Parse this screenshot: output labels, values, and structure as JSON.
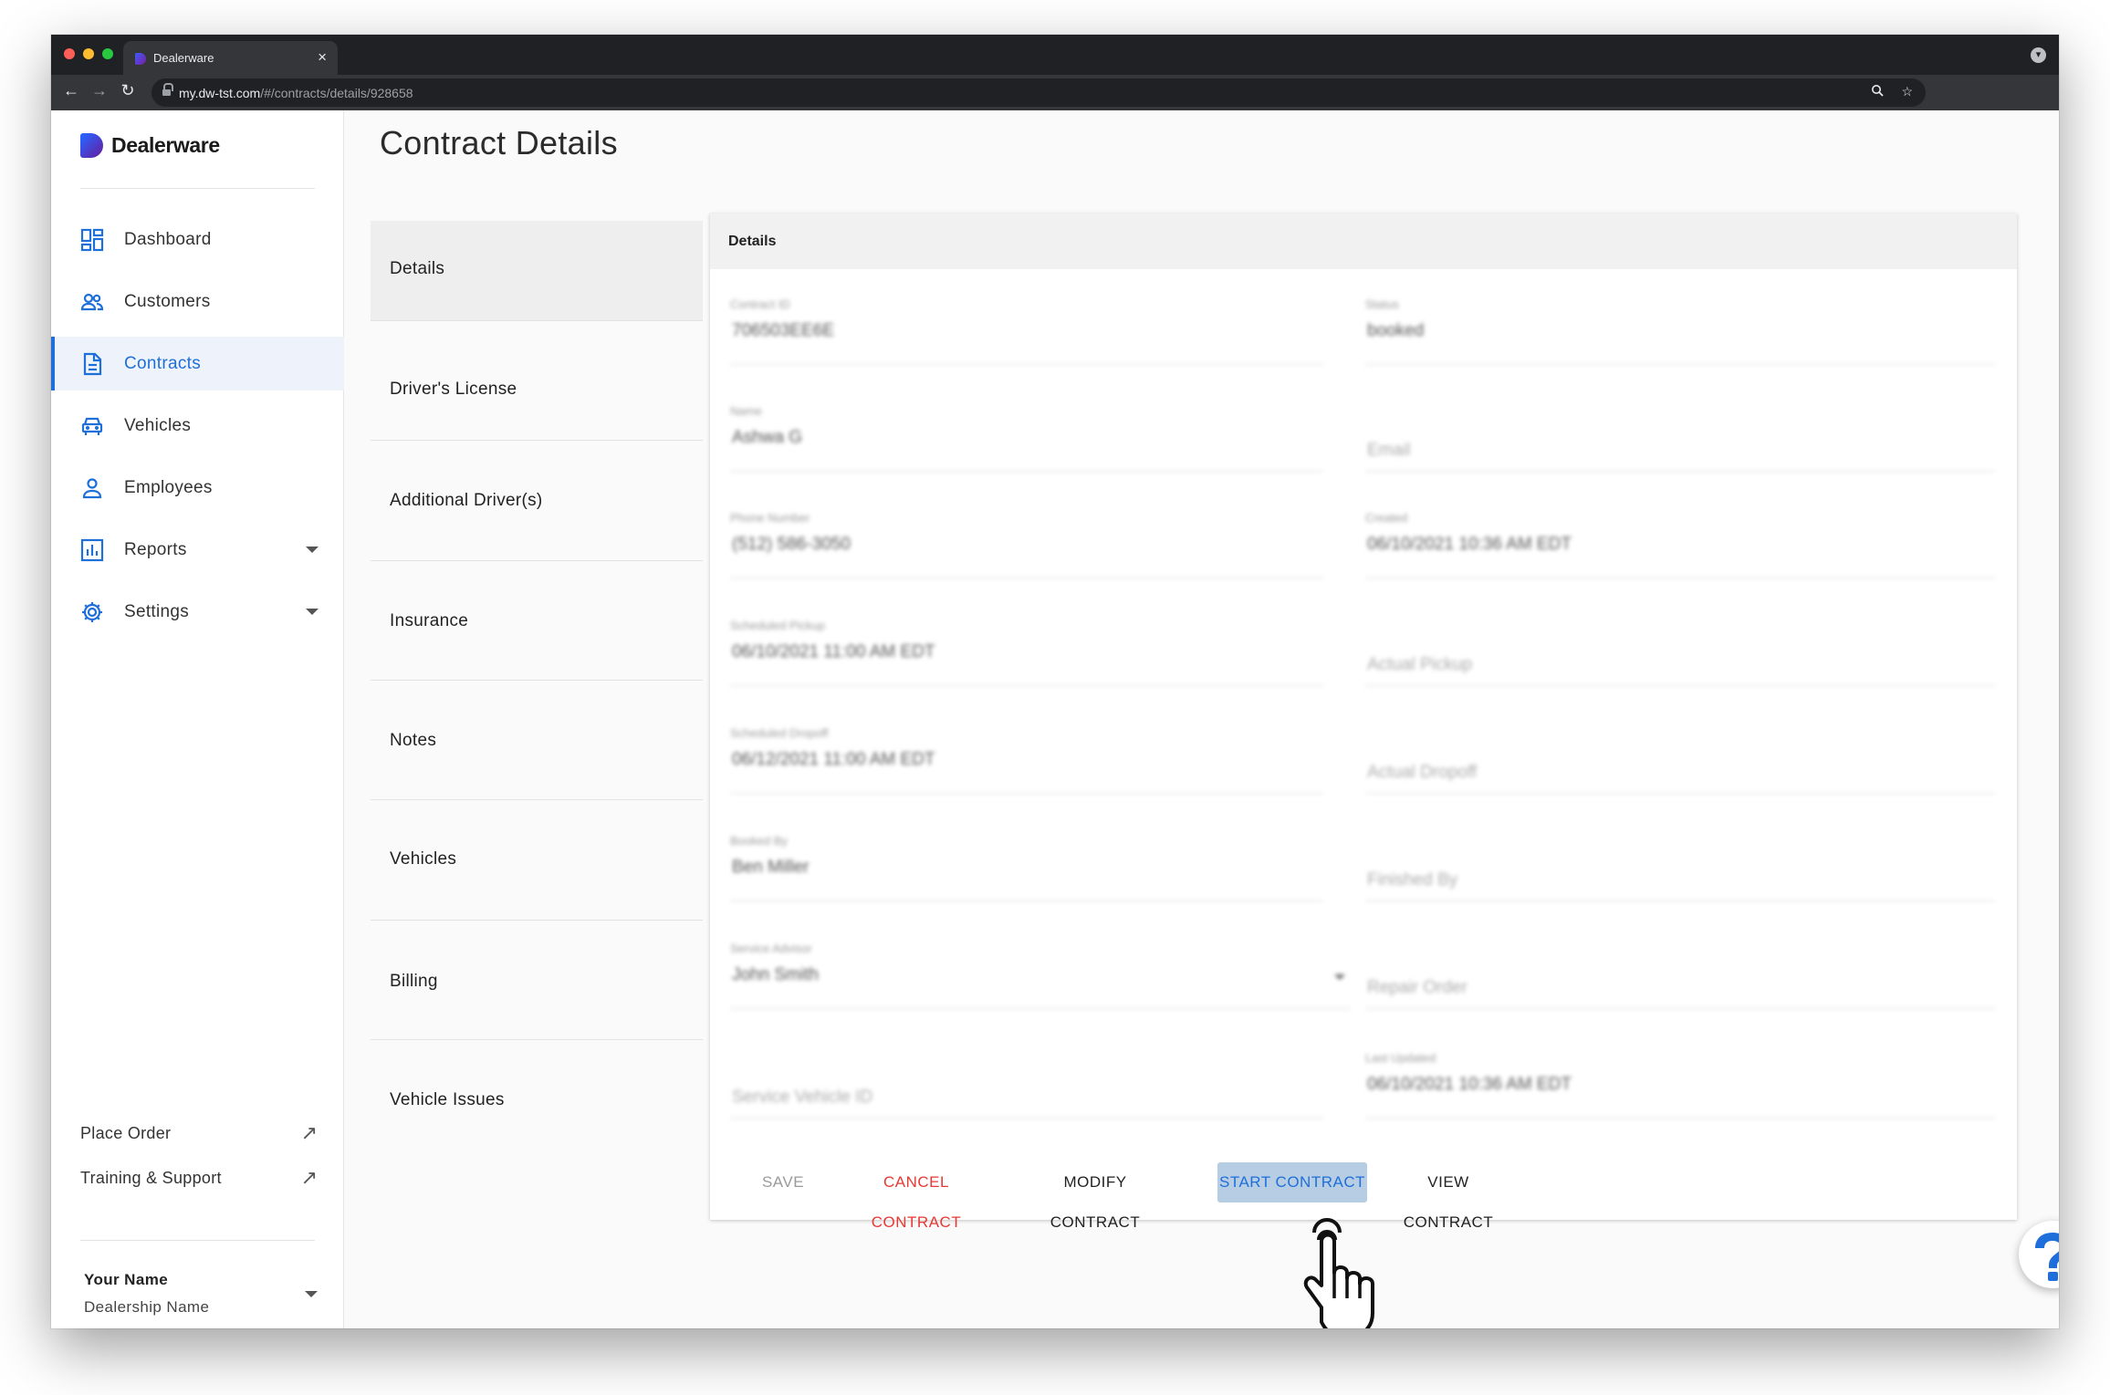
{
  "browser": {
    "tab_title": "Dealerware",
    "tab_close": "×",
    "url_host": "my.dw-tst.com",
    "url_path": "/#/contracts/details/928658"
  },
  "sidebar": {
    "brand": "Dealerware",
    "nav": [
      {
        "label": "Dashboard",
        "icon": "dashboard-icon"
      },
      {
        "label": "Customers",
        "icon": "people-icon"
      },
      {
        "label": "Contracts",
        "icon": "document-icon",
        "active": true
      },
      {
        "label": "Vehicles",
        "icon": "car-icon"
      },
      {
        "label": "Employees",
        "icon": "person-icon"
      },
      {
        "label": "Reports",
        "icon": "bar-chart-icon",
        "expandable": true
      },
      {
        "label": "Settings",
        "icon": "gear-icon",
        "expandable": true
      }
    ],
    "links": [
      {
        "label": "Place Order",
        "icon": "external-arrow-icon"
      },
      {
        "label": "Training & Support",
        "icon": "external-arrow-icon"
      }
    ],
    "user": {
      "name": "Your Name",
      "dealership": "Dealership Name"
    }
  },
  "main": {
    "title": "Contract Details",
    "subnav": [
      "Details",
      "Driver's License",
      "Additional Driver(s)",
      "Insurance",
      "Notes",
      "Vehicles",
      "Billing",
      "Vehicle Issues"
    ],
    "card_title": "Details",
    "fields": {
      "contract_id": {
        "label": "Contract ID",
        "value": "706503EE6E"
      },
      "status": {
        "label": "Status",
        "value": "booked"
      },
      "name": {
        "label": "Name",
        "value": "Ashwa G"
      },
      "email": {
        "placeholder": "Email"
      },
      "phone": {
        "label": "Phone Number",
        "value": "(512) 586-3050"
      },
      "created": {
        "label": "Created",
        "value": "06/10/2021 10:36 AM EDT"
      },
      "sched_pickup": {
        "label": "Scheduled Pickup",
        "value": "06/10/2021 11:00 AM EDT"
      },
      "actual_pickup": {
        "placeholder": "Actual Pickup"
      },
      "sched_dropoff": {
        "label": "Scheduled Dropoff",
        "value": "06/12/2021 11:00 AM EDT"
      },
      "actual_dropoff": {
        "placeholder": "Actual Dropoff"
      },
      "booked_by": {
        "label": "Booked By",
        "value": "Ben Miller"
      },
      "finished_by": {
        "placeholder": "Finished By"
      },
      "service_advisor": {
        "label": "Service Advisor",
        "value": "John Smith"
      },
      "repair_order": {
        "placeholder": "Repair Order"
      },
      "service_vehicle_id": {
        "placeholder": "Service Vehicle ID"
      },
      "last_updated": {
        "label": "Last Updated",
        "value": "06/10/2021 10:36 AM EDT"
      }
    },
    "actions": {
      "save": "SAVE",
      "cancel": "CANCEL CONTRACT",
      "modify": "MODIFY CONTRACT",
      "start": "START CONTRACT",
      "view": "VIEW CONTRACT"
    }
  },
  "help": {
    "icon": "question-mark-icon"
  },
  "colors": {
    "accent": "#1e6fd9",
    "danger": "#e53935",
    "highlight": "#b7cde3"
  }
}
